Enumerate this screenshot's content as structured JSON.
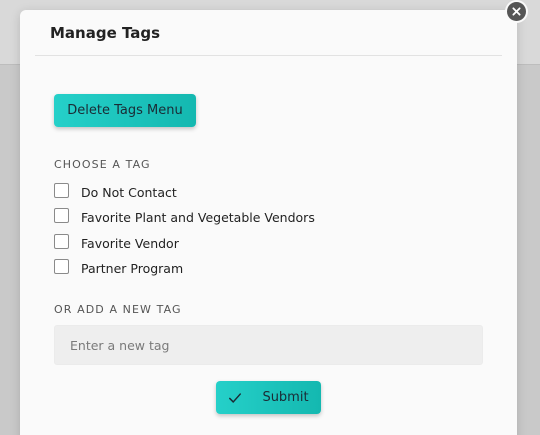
{
  "modal": {
    "title": "Manage Tags",
    "close_icon": "close-icon",
    "delete_tags_label": "Delete Tags Menu",
    "choose_label": "CHOOSE A TAG",
    "tags": [
      {
        "label": "Do Not Contact",
        "checked": false
      },
      {
        "label": "Favorite Plant and Vegetable Vendors",
        "checked": false
      },
      {
        "label": "Favorite Vendor",
        "checked": false
      },
      {
        "label": "Partner Program",
        "checked": false
      }
    ],
    "add_label": "OR ADD A NEW TAG",
    "new_tag": {
      "value": "",
      "placeholder": "Enter a new tag"
    },
    "submit_label": "Submit",
    "submit_icon": "check-icon"
  },
  "colors": {
    "accent": "#1ec3bc",
    "overlay": "#c9c9c9",
    "modal_bg": "#fafafa",
    "input_bg": "#eeeeee"
  }
}
